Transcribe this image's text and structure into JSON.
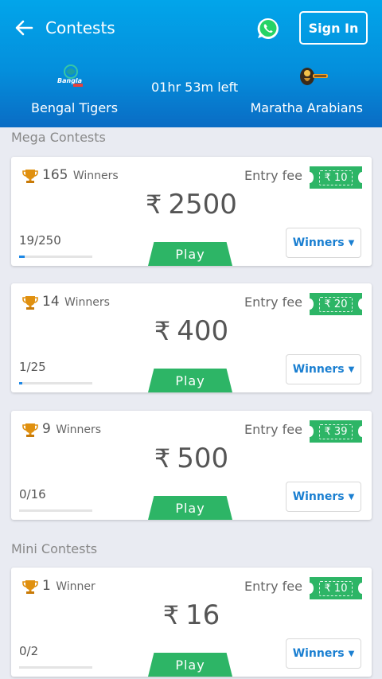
{
  "header": {
    "title": "Contests",
    "sign_in": "Sign In",
    "time_left": "01hr 53m left",
    "team_left": "Bengal Tigers",
    "team_right": "Maratha Arabians",
    "logo_left_text": "Bangla",
    "colors": {
      "bg_top": "#02a5ea",
      "bg_bottom": "#0a6cc4",
      "whatsapp": "#25d366"
    }
  },
  "sections": {
    "mega": "Mega Contests",
    "mini": "Mini Contests"
  },
  "contests": [
    {
      "winners": "165",
      "winners_word": "Winners",
      "entry_label": "Entry fee",
      "fee": "₹ 10",
      "currency": "₹",
      "prize": "2500",
      "spots": "19/250",
      "progress": 0.076,
      "play": "Play",
      "winners_btn": "Winners"
    },
    {
      "winners": "14",
      "winners_word": "Winners",
      "entry_label": "Entry fee",
      "fee": "₹ 20",
      "currency": "₹",
      "prize": "400",
      "spots": "1/25",
      "progress": 0.04,
      "play": "Play",
      "winners_btn": "Winners"
    },
    {
      "winners": "9",
      "winners_word": "Winners",
      "entry_label": "Entry fee",
      "fee": "₹ 39",
      "currency": "₹",
      "prize": "500",
      "spots": "0/16",
      "progress": 0,
      "play": "Play",
      "winners_btn": "Winners"
    },
    {
      "winners": "1",
      "winners_word": "Winner",
      "entry_label": "Entry fee",
      "fee": "₹ 10",
      "currency": "₹",
      "prize": "16",
      "spots": "0/2",
      "progress": 0,
      "play": "Play",
      "winners_btn": "Winners"
    }
  ],
  "colors": {
    "green": "#2db566",
    "blue_link": "#1a7fd1",
    "progress": "#1e88e5"
  },
  "icons": {
    "back": "arrow-left-icon",
    "whatsapp": "whatsapp-icon",
    "trophy": "trophy-icon",
    "dropdown": "caret-down-icon"
  }
}
